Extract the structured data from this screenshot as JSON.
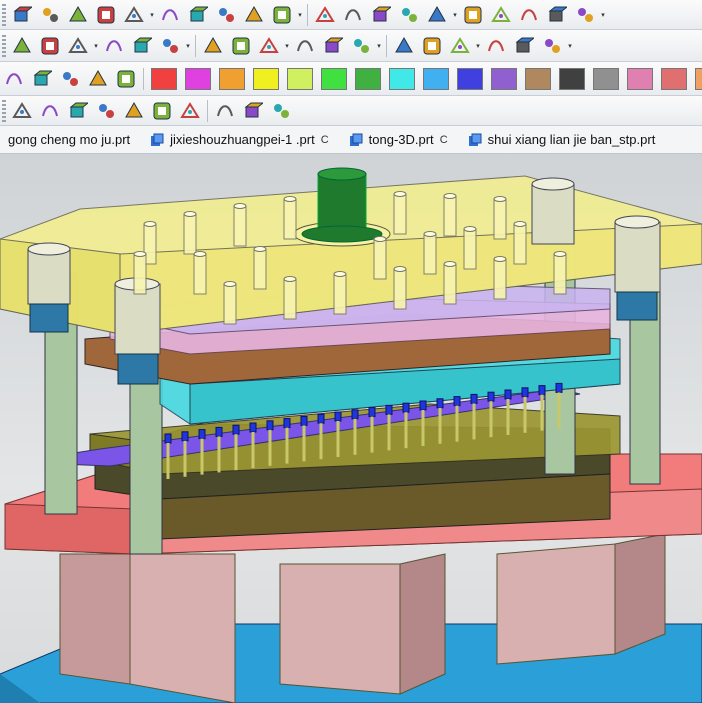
{
  "tabs": [
    {
      "label": "gong cheng mo ju.prt",
      "modified": false
    },
    {
      "label": "jixieshouzhuangpei-1 .prt",
      "modified": true
    },
    {
      "label": "tong-3D.prt",
      "modified": true
    },
    {
      "label": "shui xiang lian jie ban_stp.prt",
      "modified": false
    }
  ],
  "modified_glyph": "C",
  "palette": [
    "#f04040",
    "#e040e0",
    "#f0a030",
    "#f0f020",
    "#d0f060",
    "#40e040",
    "#40b040",
    "#40e8e8",
    "#40b0f0",
    "#4040e0",
    "#9060d0",
    "#b08860",
    "#404040",
    "#909090",
    "#e080b0",
    "#e07070",
    "#f0a060"
  ],
  "icons": {
    "row1": [
      "extrude-icon",
      "pattern-array-icon",
      "hole-array-icon",
      "boolean-icon",
      "sketch-shape-icon",
      "block-icon",
      "sweep-surface-icon",
      "face-offset-icon",
      "sew-icon",
      "thicken-icon",
      "shell-icon",
      "draft-icon",
      "wedge-icon",
      "sphere-icon",
      "table-icon",
      "mold-plate-icon",
      "slot-icon",
      "box-icon",
      "wall-icon",
      "rib-icon"
    ],
    "row2": [
      "trim-icon",
      "mirror-icon",
      "move-icon",
      "split-line-icon",
      "intersect-icon",
      "spline-icon",
      "angle-dim-icon",
      "parallel-icon",
      "perpendicular-icon",
      "chamfer-icon",
      "fillet-icon",
      "measure-icon",
      "section-icon",
      "hatch-icon",
      "mass-icon",
      "assembly-icon",
      "color-wheel-icon",
      "delete-body-icon"
    ],
    "row3": [
      "curve-a-icon",
      "curve-b-icon",
      "curve-c-icon",
      "surface-curve-icon",
      "arc-icon"
    ],
    "row4": [
      "line-select-icon",
      "spline-select-icon",
      "trim-select-icon",
      "center-point-icon",
      "circle-point-icon",
      "crosshair-icon",
      "line-tool-icon",
      "layer-icon",
      "stack-icon",
      "grid-icon"
    ]
  }
}
